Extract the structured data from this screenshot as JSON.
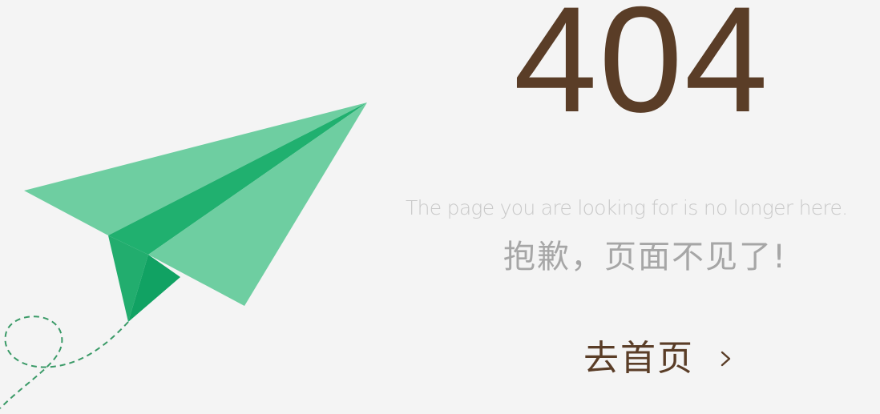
{
  "error": {
    "code": "404",
    "subtitle": "The page you are looking for is no longer here.",
    "message": "抱歉，页面不见了!"
  },
  "navigation": {
    "home_label": "去首页",
    "home_icon": "chevron-right-icon"
  },
  "illustration": {
    "name": "paper-plane-icon",
    "colors": {
      "light": "#6ecea1",
      "mid": "#20b06f",
      "dark": "#11a263",
      "trail": "#3a9a67"
    }
  },
  "theme": {
    "background": "#f4f4f4",
    "accent_brown": "#5a3d27",
    "muted_text": "#a6a6a6",
    "faint_text": "#c9c9c9"
  }
}
